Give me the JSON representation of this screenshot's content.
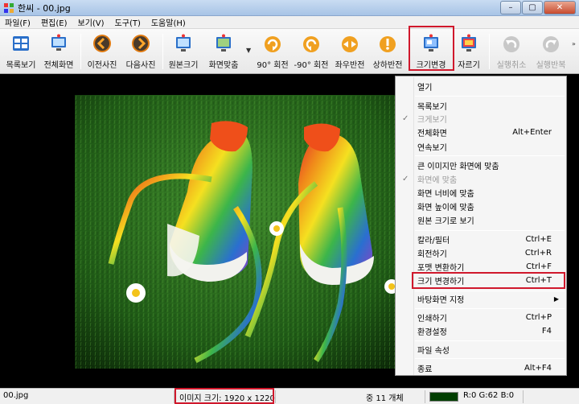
{
  "window": {
    "title": "한씨 - 00.jpg",
    "controls": {
      "minimize": "–",
      "maximize": "▢",
      "close": "✕"
    }
  },
  "menubar": {
    "items": [
      "파일(F)",
      "편집(E)",
      "보기(V)",
      "도구(T)",
      "도움말(H)"
    ]
  },
  "toolbar": {
    "buttons": [
      {
        "label": "목록보기",
        "icon": "list-view-icon",
        "enabled": true
      },
      {
        "label": "전체화면",
        "icon": "fullscreen-icon",
        "enabled": true
      },
      {
        "label": "이전사진",
        "icon": "previous-arrow-icon",
        "enabled": true
      },
      {
        "label": "다음사진",
        "icon": "next-arrow-icon",
        "enabled": true
      },
      {
        "label": "원본크기",
        "icon": "original-size-icon",
        "enabled": true
      },
      {
        "label": "화면맞춤",
        "icon": "fit-screen-icon",
        "enabled": true
      },
      {
        "label": "90° 회전",
        "icon": "rotate-cw-icon",
        "enabled": true
      },
      {
        "label": "-90° 회전",
        "icon": "rotate-ccw-icon",
        "enabled": true
      },
      {
        "label": "좌우반전",
        "icon": "flip-horizontal-icon",
        "enabled": true
      },
      {
        "label": "상하반전",
        "icon": "flip-vertical-icon",
        "enabled": true
      },
      {
        "label": "크기변경",
        "icon": "resize-icon",
        "enabled": true,
        "highlighted": true
      },
      {
        "label": "자르기",
        "icon": "crop-icon",
        "enabled": true
      },
      {
        "label": "실행취소",
        "icon": "undo-icon",
        "enabled": false
      },
      {
        "label": "실행반복",
        "icon": "redo-icon",
        "enabled": false
      }
    ]
  },
  "context_menu": {
    "items": [
      {
        "label": "열기",
        "shortcut": ""
      },
      {
        "label": "목록보기",
        "shortcut": ""
      },
      {
        "label": "크게보기",
        "shortcut": "",
        "checked": true,
        "disabled": true
      },
      {
        "label": "전체화면",
        "shortcut": "Alt+Enter"
      },
      {
        "label": "연속보기",
        "shortcut": ""
      },
      {
        "label": "큰 이미지만 화면에 맞춤",
        "shortcut": ""
      },
      {
        "label": "화면에 맞춤",
        "shortcut": "",
        "checked": true,
        "disabled": true
      },
      {
        "label": "화면 너비에 맞춤",
        "shortcut": ""
      },
      {
        "label": "화면 높이에 맞춤",
        "shortcut": ""
      },
      {
        "label": "원본 크기로 보기",
        "shortcut": ""
      },
      {
        "label": "칼라/필터",
        "shortcut": "Ctrl+E"
      },
      {
        "label": "회전하기",
        "shortcut": "Ctrl+R"
      },
      {
        "label": "포맷 변환하기",
        "shortcut": "Ctrl+F"
      },
      {
        "label": "크기 변경하기",
        "shortcut": "Ctrl+T",
        "highlighted": true
      },
      {
        "label": "바탕화면 지정",
        "shortcut": "",
        "submenu": true
      },
      {
        "label": "인쇄하기",
        "shortcut": "Ctrl+P"
      },
      {
        "label": "환경설정",
        "shortcut": "F4"
      },
      {
        "label": "파일 속성",
        "shortcut": ""
      },
      {
        "label": "종료",
        "shortcut": "Alt+F4"
      }
    ]
  },
  "statusbar": {
    "filename": "00.jpg",
    "image_size": "이미지 크기: 1920 x 1220",
    "count": "중 11 개체",
    "color_value": "R:0 G:62 B:0",
    "swatch_color": "#003e00"
  },
  "colors": {
    "highlight": "#d0182c",
    "menu_bg": "#f5f5f5",
    "viewer_bg": "#000000"
  }
}
